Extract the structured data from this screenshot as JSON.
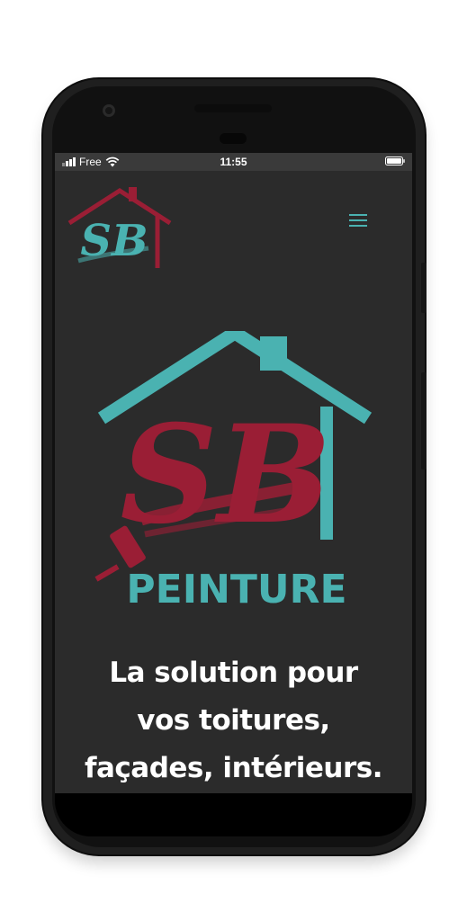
{
  "status_bar": {
    "carrier": "Free",
    "time": "11:55"
  },
  "header": {
    "logo_text": "SB",
    "menu_icon": "hamburger-icon"
  },
  "hero": {
    "logo_monogram": "SB",
    "logo_word": "PEINTURE",
    "headline_lines": [
      "La solution pour",
      "vos toitures,",
      "façades, intérieurs."
    ]
  },
  "colors": {
    "teal": "#4ab2b1",
    "burgundy": "#9a1e35",
    "background": "#2b2b2b",
    "text": "#ffffff"
  }
}
